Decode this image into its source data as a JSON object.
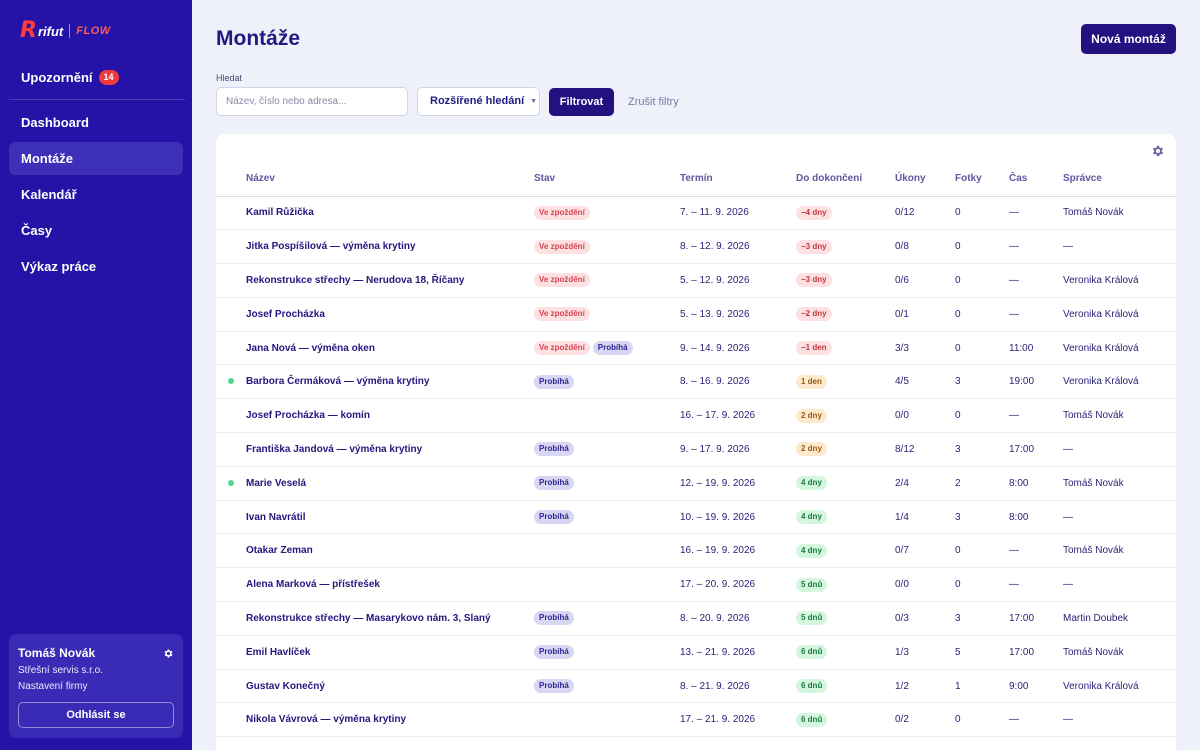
{
  "brand": {
    "r": "R",
    "word": "rifut",
    "flow": "FLOW"
  },
  "sidebar": {
    "notifications": {
      "label": "Upozornění",
      "count": "14"
    },
    "items": [
      {
        "label": "Dashboard",
        "active": false
      },
      {
        "label": "Montáže",
        "active": true
      },
      {
        "label": "Kalendář",
        "active": false
      },
      {
        "label": "Časy",
        "active": false
      },
      {
        "label": "Výkaz práce",
        "active": false
      }
    ],
    "user": {
      "name": "Tomáš Novák",
      "company": "Střešní servis s.r.o.",
      "settings": "Nastavení firmy",
      "logout": "Odhlásit se"
    }
  },
  "header": {
    "title": "Montáže",
    "new_button": "Nová montáž"
  },
  "filters": {
    "search_label": "Hledat",
    "search_placeholder": "Název, číslo nebo adresa...",
    "advanced": "Rozšířené hledání",
    "filter_button": "Filtrovat",
    "clear": "Zrušit filtry"
  },
  "table": {
    "columns": [
      "Název",
      "Stav",
      "Termín",
      "Do dokončení",
      "Úkony",
      "Fotky",
      "Čas",
      "Správce"
    ],
    "rows": [
      {
        "dot": false,
        "name": "Kamil Růžička",
        "status": [
          "Ve zpoždění"
        ],
        "term": "7. – 11. 9. 2026",
        "due": "−4 dny",
        "due_color": "red",
        "tasks": "0/12",
        "photos": "0",
        "time": "—",
        "manager": "Tomáš Novák"
      },
      {
        "dot": false,
        "name": "Jitka Pospíšilová — výměna krytiny",
        "status": [
          "Ve zpoždění"
        ],
        "term": "8. – 12. 9. 2026",
        "due": "−3 dny",
        "due_color": "red",
        "tasks": "0/8",
        "photos": "0",
        "time": "—",
        "manager": "—"
      },
      {
        "dot": false,
        "name": "Rekonstrukce střechy — Nerudova 18, Říčany",
        "status": [
          "Ve zpoždění"
        ],
        "term": "5. – 12. 9. 2026",
        "due": "−3 dny",
        "due_color": "red",
        "tasks": "0/6",
        "photos": "0",
        "time": "—",
        "manager": "Veronika Králová"
      },
      {
        "dot": false,
        "name": "Josef Procházka",
        "status": [
          "Ve zpoždění"
        ],
        "term": "5. – 13. 9. 2026",
        "due": "−2 dny",
        "due_color": "red",
        "tasks": "0/1",
        "photos": "0",
        "time": "—",
        "manager": "Veronika Králová"
      },
      {
        "dot": false,
        "name": "Jana Nová — výměna oken",
        "status": [
          "Ve zpoždění",
          "Probíhá"
        ],
        "term": "9. – 14. 9. 2026",
        "due": "−1 den",
        "due_color": "red",
        "tasks": "3/3",
        "photos": "0",
        "time": "11:00",
        "manager": "Veronika Králová"
      },
      {
        "dot": true,
        "name": "Barbora Čermáková — výměna krytiny",
        "status": [
          "Probíhá"
        ],
        "term": "8. – 16. 9. 2026",
        "due": "1 den",
        "due_color": "orange",
        "tasks": "4/5",
        "photos": "3",
        "time": "19:00",
        "manager": "Veronika Králová"
      },
      {
        "dot": false,
        "name": "Josef Procházka — komín",
        "status": [],
        "term": "16. – 17. 9. 2026",
        "due": "2 dny",
        "due_color": "orange",
        "tasks": "0/0",
        "photos": "0",
        "time": "—",
        "manager": "Tomáš Novák"
      },
      {
        "dot": false,
        "name": "Františka Jandová — výměna krytiny",
        "status": [
          "Probíhá"
        ],
        "term": "9. – 17. 9. 2026",
        "due": "2 dny",
        "due_color": "orange",
        "tasks": "8/12",
        "photos": "3",
        "time": "17:00",
        "manager": "—"
      },
      {
        "dot": true,
        "name": "Marie Veselá",
        "status": [
          "Probíhá"
        ],
        "term": "12. – 19. 9. 2026",
        "due": "4 dny",
        "due_color": "green",
        "tasks": "2/4",
        "photos": "2",
        "time": "8:00",
        "manager": "Tomáš Novák"
      },
      {
        "dot": false,
        "name": "Ivan Navrátil",
        "status": [
          "Probíhá"
        ],
        "term": "10. – 19. 9. 2026",
        "due": "4 dny",
        "due_color": "green",
        "tasks": "1/4",
        "photos": "3",
        "time": "8:00",
        "manager": "—"
      },
      {
        "dot": false,
        "name": "Otakar Zeman",
        "status": [],
        "term": "16. – 19. 9. 2026",
        "due": "4 dny",
        "due_color": "green",
        "tasks": "0/7",
        "photos": "0",
        "time": "—",
        "manager": "Tomáš Novák"
      },
      {
        "dot": false,
        "name": "Alena Marková — přístřešek",
        "status": [],
        "term": "17. – 20. 9. 2026",
        "due": "5 dnů",
        "due_color": "green",
        "tasks": "0/0",
        "photos": "0",
        "time": "—",
        "manager": "—"
      },
      {
        "dot": false,
        "name": "Rekonstrukce střechy — Masarykovo nám. 3, Slaný",
        "status": [
          "Probíhá"
        ],
        "term": "8. – 20. 9. 2026",
        "due": "5 dnů",
        "due_color": "green",
        "tasks": "0/3",
        "photos": "3",
        "time": "17:00",
        "manager": "Martin Doubek"
      },
      {
        "dot": false,
        "name": "Emil Havlíček",
        "status": [
          "Probíhá"
        ],
        "term": "13. – 21. 9. 2026",
        "due": "6 dnů",
        "due_color": "green",
        "tasks": "1/3",
        "photos": "5",
        "time": "17:00",
        "manager": "Tomáš Novák"
      },
      {
        "dot": false,
        "name": "Gustav Konečný",
        "status": [
          "Probíhá"
        ],
        "term": "8. – 21. 9. 2026",
        "due": "6 dnů",
        "due_color": "green",
        "tasks": "1/2",
        "photos": "1",
        "time": "9:00",
        "manager": "Veronika Králová"
      },
      {
        "dot": false,
        "name": "Nikola Vávrová — výměna krytiny",
        "status": [],
        "term": "17. – 21. 9. 2026",
        "due": "6 dnů",
        "due_color": "green",
        "tasks": "0/2",
        "photos": "0",
        "time": "—",
        "manager": "—"
      }
    ]
  },
  "colors": {
    "sidebar": "#2413a6",
    "accent": "#24117f",
    "late": "#d6454f",
    "running": "#2e2690",
    "dot": "#57d38c"
  }
}
